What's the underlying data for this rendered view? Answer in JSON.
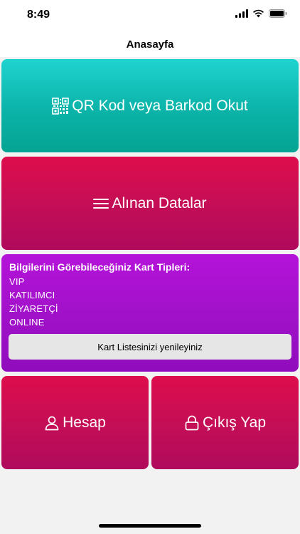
{
  "status": {
    "time": "8:49",
    "signal_icon": "signal-bars-icon",
    "wifi_icon": "wifi-icon",
    "battery_icon": "battery-icon"
  },
  "nav": {
    "title": "Anasayfa"
  },
  "tiles": {
    "scan": {
      "label": "QR Kod veya Barkod Okut",
      "icon": "qr-code-icon"
    },
    "data": {
      "label": "Alınan Datalar",
      "icon": "list-icon"
    },
    "account": {
      "label": "Hesap",
      "icon": "person-icon"
    },
    "logout": {
      "label": "Çıkış Yap",
      "icon": "lock-icon"
    }
  },
  "card_types": {
    "title": "Bilgilerini Görebileceğiniz Kart Tipleri:",
    "items": [
      "VIP",
      "KATILIMCI",
      "ZİYARETÇİ",
      "ONLINE"
    ],
    "refresh_label": "Kart Listesinizi yenileyiniz"
  },
  "colors": {
    "scan_tile": "#0bb3a8",
    "data_tile": "#c50e56",
    "card_panel": "#a011c8",
    "refresh_button": "#e6e6e6"
  }
}
